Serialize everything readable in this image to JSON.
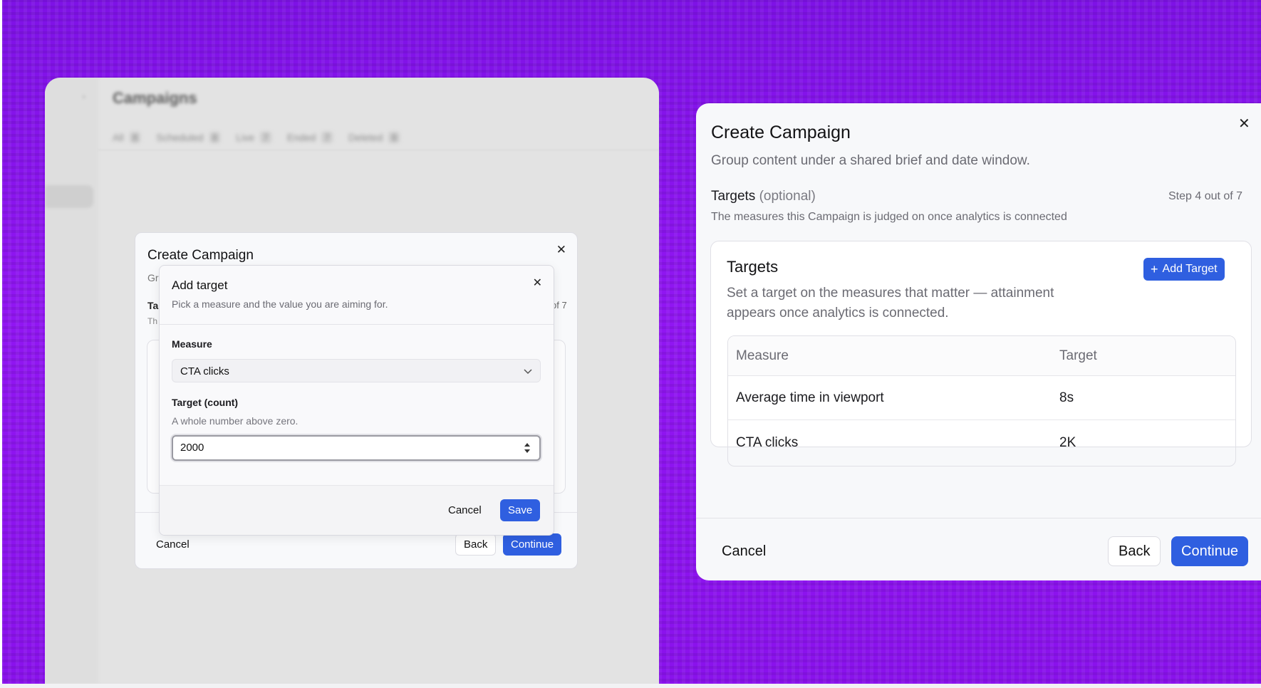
{
  "background_app": {
    "title": "Campaigns",
    "tabs": [
      {
        "label": "All",
        "count": "8"
      },
      {
        "label": "Scheduled",
        "count": "8"
      },
      {
        "label": "Live",
        "count": "7"
      },
      {
        "label": "Ended",
        "count": "7"
      },
      {
        "label": "Deleted",
        "count": "8"
      }
    ]
  },
  "small_dialog": {
    "title": "Create Campaign",
    "subtitle_peek": "Gr",
    "section_peek": "Ta",
    "section_desc_peek": "Th",
    "step_peek": "of 7",
    "cancel": "Cancel",
    "back": "Back",
    "continue": "Continue"
  },
  "add_target_popover": {
    "title": "Add target",
    "description": "Pick a measure and the value you are aiming for.",
    "measure_label": "Measure",
    "measure_value": "CTA clicks",
    "target_label": "Target (count)",
    "target_hint": "A whole number above zero.",
    "target_value": "2000",
    "cancel": "Cancel",
    "save": "Save"
  },
  "large_dialog": {
    "title": "Create Campaign",
    "subtitle": "Group content under a shared brief and date window.",
    "section_title": "Targets",
    "section_optional": "(optional)",
    "step": "Step 4 out of 7",
    "section_desc": "The measures this Campaign is judged on once analytics is connected",
    "card": {
      "title": "Targets",
      "description": "Set a target on the measures that matter — attainment appears once analytics is connected.",
      "add_button": "Add Target",
      "columns": [
        "Measure",
        "Target"
      ],
      "rows": [
        {
          "measure": "Average time in viewport",
          "target": "8s"
        },
        {
          "measure": "CTA clicks",
          "target": "2K"
        }
      ]
    },
    "cancel": "Cancel",
    "back": "Back",
    "continue": "Continue"
  },
  "colors": {
    "background": "#8d14f0",
    "primary_button": "#2f5fe0"
  }
}
